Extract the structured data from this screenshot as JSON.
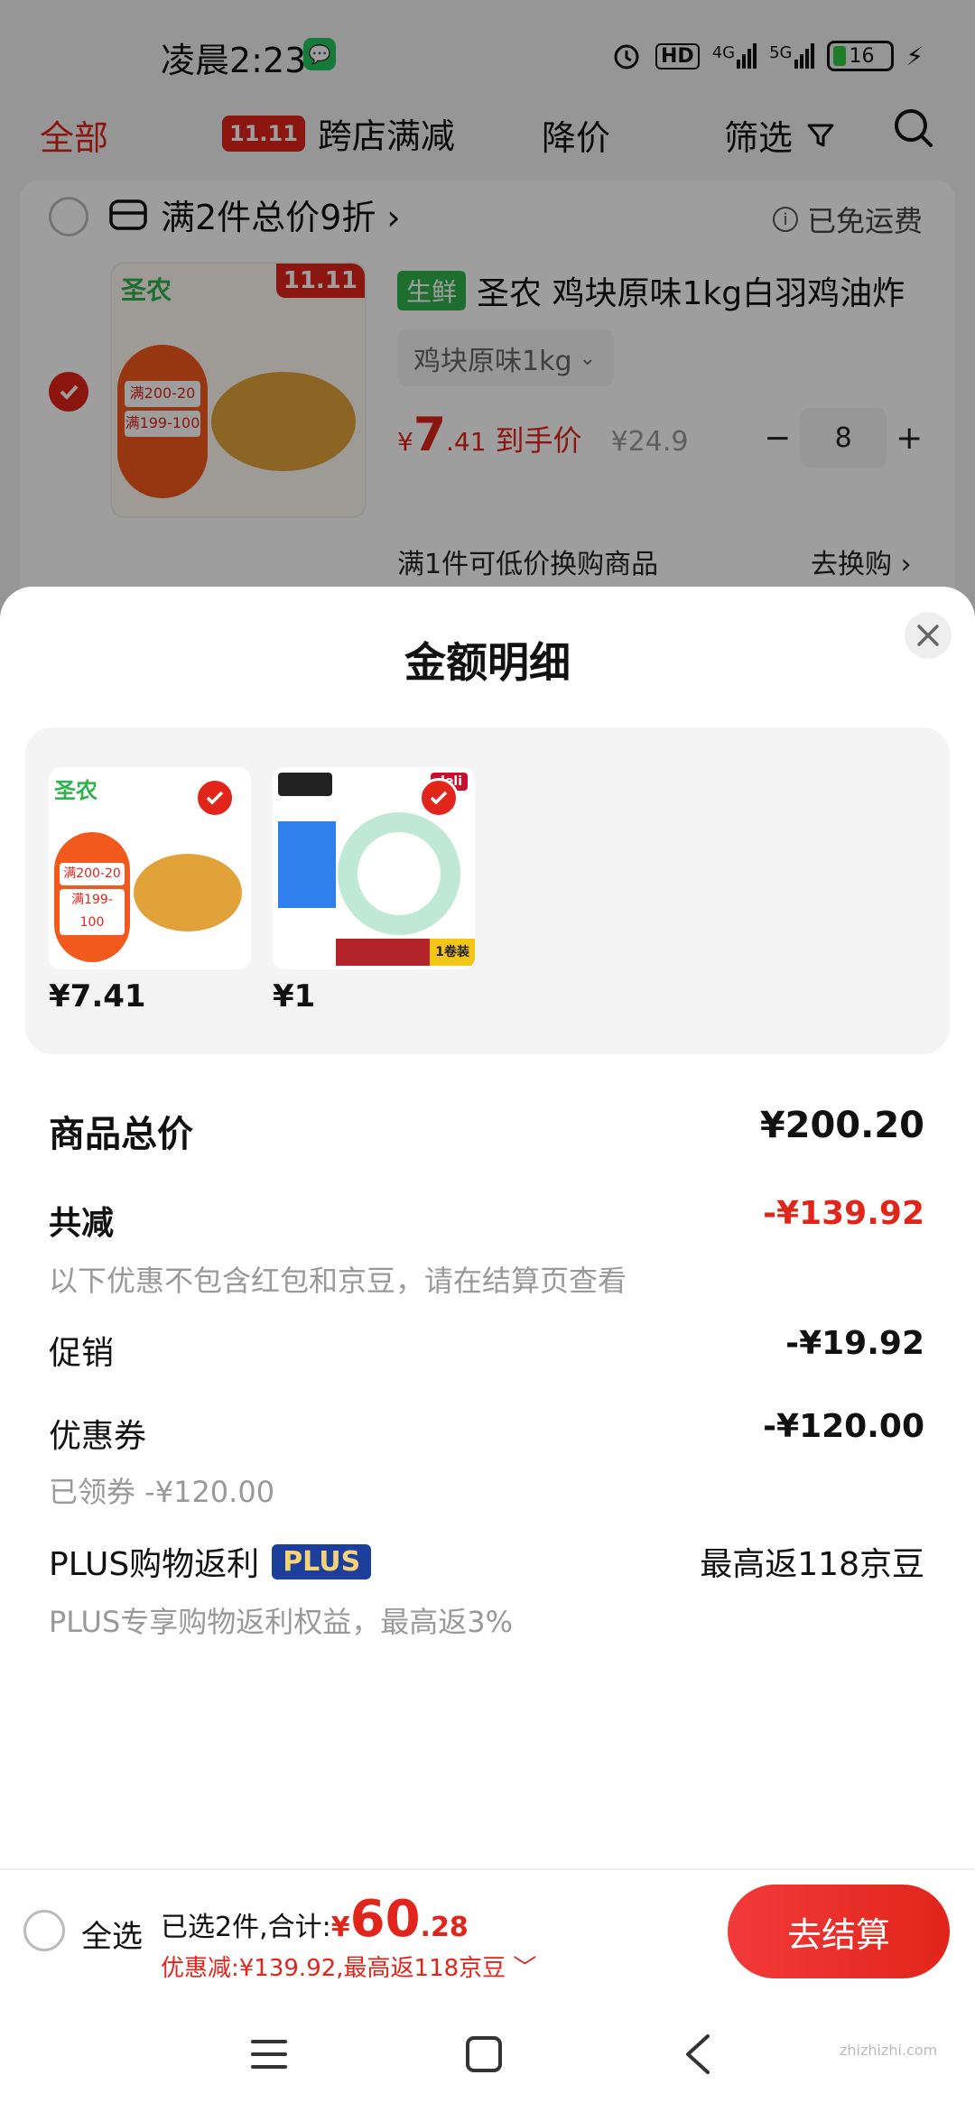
{
  "status_bar": {
    "time": "凌晨2:23",
    "hd": "HD",
    "net1": "4G",
    "net2": "5G",
    "battery": "16"
  },
  "top_nav": {
    "all": "全部",
    "badge": "11.11",
    "cross_store": "跨店满减",
    "price_drop": "降价",
    "filter": "筛选"
  },
  "cart": {
    "promo": "满2件总价9折 ›",
    "free_shipping": "已免运费",
    "product": {
      "tag": "生鲜",
      "title": "圣农 鸡块原味1kg白羽鸡油炸",
      "spec": "鸡块原味1kg",
      "price_symbol": "¥",
      "price_int": "7",
      "price_dec": ".41",
      "price_note": "到手价",
      "orig_price": "¥24.9",
      "qty": "8",
      "image_brand": "圣农",
      "image_badge": "11.11",
      "image_promo1": "满200-20",
      "image_promo2": "满199-100"
    },
    "exchange": "满1件可低价换购商品",
    "exchange_go": "去换购 ›"
  },
  "sheet": {
    "title": "金额明细",
    "items": [
      {
        "price": "¥7.41",
        "brand": "圣农",
        "promo1": "满200-20",
        "promo2": "满199-100"
      },
      {
        "price": "¥1",
        "brand": "deli",
        "label": "1卷装"
      }
    ],
    "total_label": "商品总价",
    "total_value": "¥200.20",
    "discount_label": "共减",
    "discount_value": "-¥139.92",
    "discount_note": "以下优惠不包含红包和京豆，请在结算页查看",
    "promo_label": "促销",
    "promo_value": "-¥19.92",
    "coupon_label": "优惠券",
    "coupon_value": "-¥120.00",
    "coupon_note": "已领券 -¥120.00",
    "plus_label": "PLUS购物返利",
    "plus_badge": "PLUS",
    "plus_value": "最高返118京豆",
    "plus_note": "PLUS专享购物返利权益，最高返3%"
  },
  "bottom_bar": {
    "select_all": "全选",
    "selected_text": "已选2件,合计:",
    "currency": "¥",
    "total_int": "60",
    "total_dec": ".28",
    "saving_text": "优惠减:¥139.92,最高返118京豆 ﹀",
    "checkout": "去结算"
  },
  "watermark": "zhizhizhi.com",
  "colors": {
    "accent": "#e1251b",
    "plus_badge": "#1d3f9c",
    "fresh_tag": "#2fb24c"
  }
}
